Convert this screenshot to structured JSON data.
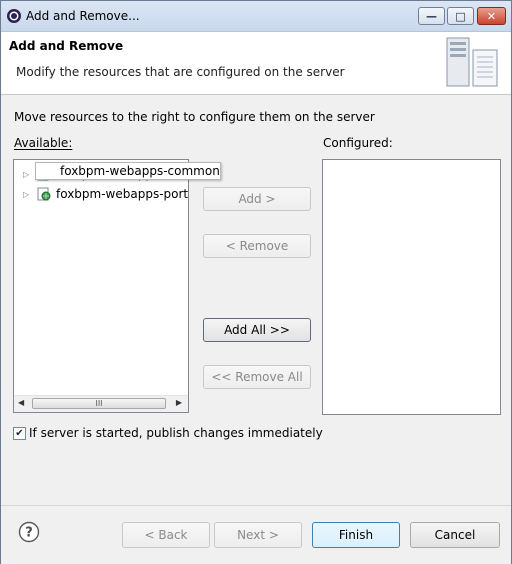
{
  "window": {
    "title": "Add and Remove..."
  },
  "header": {
    "title": "Add and Remove",
    "description": "Modify the resources that are configured on the server"
  },
  "body": {
    "instruction": "Move resources to the right to configure them on the server",
    "available_label": "Available:",
    "configured_label": "Configured:",
    "available_items": [
      {
        "label": "foxbpm-webapps-common"
      },
      {
        "label": "foxbpm-webapps-port"
      }
    ],
    "tooltip_text": "foxbpm-webapps-common",
    "scroll_thumb_glyph": "III"
  },
  "buttons": {
    "add": "Add >",
    "remove": "< Remove",
    "add_all": "Add All >>",
    "remove_all": "<< Remove All"
  },
  "option": {
    "checked": true,
    "label": "If server is started, publish changes immediately"
  },
  "footer": {
    "back": "< Back",
    "next": "Next >",
    "finish": "Finish",
    "cancel": "Cancel"
  },
  "icons": {
    "title": "eclipse-icon",
    "header": "server-icon",
    "item": "web-project-icon",
    "help": "help-icon"
  },
  "colors": {
    "close_button": "#c9452f",
    "default_button_border": "#3c7fb1"
  }
}
